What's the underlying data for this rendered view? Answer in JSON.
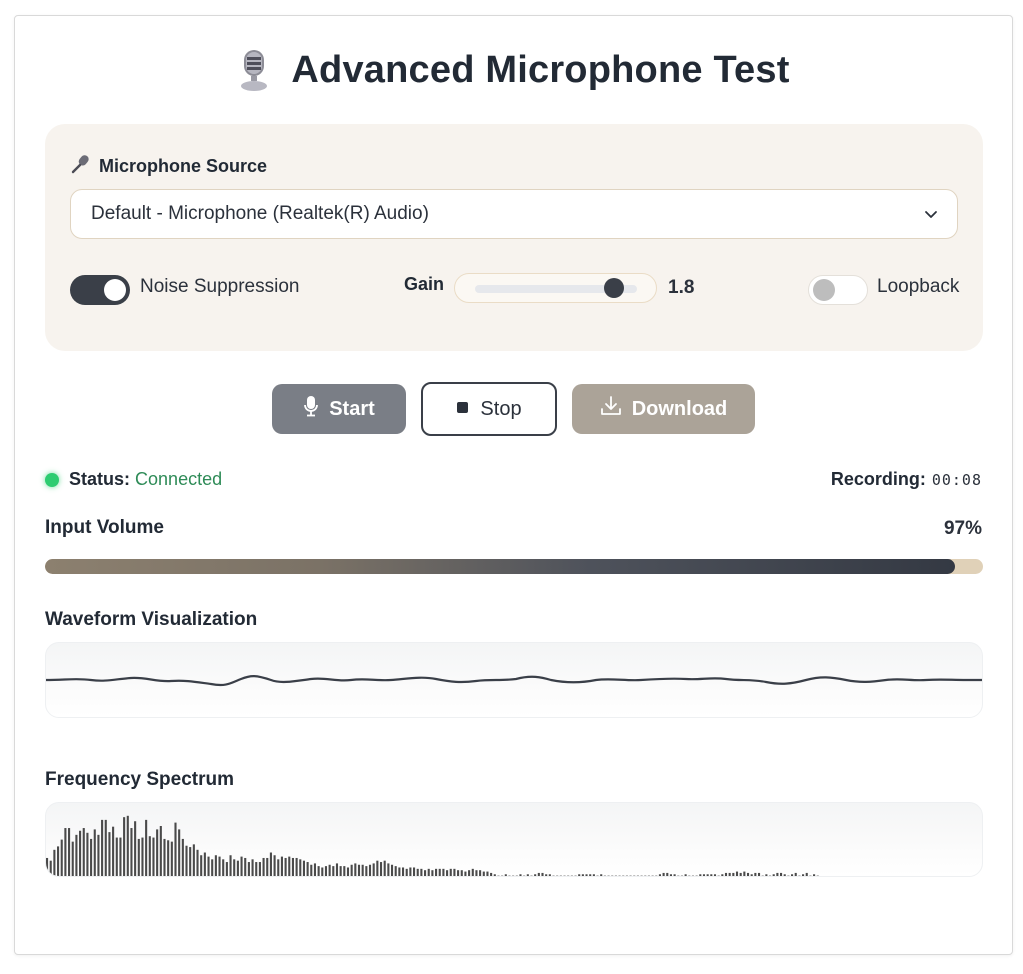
{
  "header": {
    "title": "Advanced Microphone Test",
    "icon": "studio-microphone-icon"
  },
  "source": {
    "label": "Microphone Source",
    "icon": "microphone-icon",
    "selected": "Default - Microphone (Realtek(R) Audio)"
  },
  "controls": {
    "noise_suppression": {
      "label": "Noise Suppression",
      "enabled": true
    },
    "gain": {
      "label": "Gain",
      "value": "1.8",
      "level": 0.86
    },
    "loopback": {
      "label": "Loopback",
      "enabled": false
    }
  },
  "buttons": {
    "start_label": "Start",
    "stop_label": "Stop",
    "download_label": "Download"
  },
  "status": {
    "label": "Status:",
    "value": "Connected",
    "recording_label": "Recording:",
    "recording_time": "00:08"
  },
  "volume": {
    "label": "Input Volume",
    "percent_text": "97%",
    "level": 0.97
  },
  "waveform": {
    "label": "Waveform Visualization"
  },
  "spectrum": {
    "label": "Frequency Spectrum",
    "bars": [
      0.28,
      0.24,
      0.4,
      0.45,
      0.55,
      0.72,
      0.72,
      0.52,
      0.62,
      0.68,
      0.72,
      0.65,
      0.56,
      0.7,
      0.62,
      0.84,
      0.84,
      0.66,
      0.74,
      0.58,
      0.58,
      0.88,
      0.9,
      0.72,
      0.82,
      0.56,
      0.58,
      0.84,
      0.6,
      0.58,
      0.7,
      0.75,
      0.56,
      0.54,
      0.52,
      0.8,
      0.7,
      0.56,
      0.46,
      0.44,
      0.48,
      0.4,
      0.32,
      0.36,
      0.3,
      0.26,
      0.32,
      0.3,
      0.26,
      0.22,
      0.32,
      0.26,
      0.24,
      0.3,
      0.28,
      0.22,
      0.26,
      0.22,
      0.22,
      0.28,
      0.28,
      0.36,
      0.32,
      0.26,
      0.3,
      0.28,
      0.3,
      0.28,
      0.28,
      0.26,
      0.24,
      0.22,
      0.18,
      0.2,
      0.16,
      0.14,
      0.16,
      0.18,
      0.16,
      0.2,
      0.16,
      0.16,
      0.14,
      0.18,
      0.2,
      0.18,
      0.18,
      0.16,
      0.18,
      0.2,
      0.24,
      0.22,
      0.24,
      0.2,
      0.18,
      0.16,
      0.14,
      0.14,
      0.12,
      0.14,
      0.14,
      0.12,
      0.12,
      0.1,
      0.12,
      0.1,
      0.12,
      0.12,
      0.12,
      0.1,
      0.12,
      0.12,
      0.1,
      0.1,
      0.08,
      0.1,
      0.12,
      0.1,
      0.1,
      0.08,
      0.08,
      0.06,
      0.04,
      0.02,
      0.02,
      0.04,
      0.02,
      0.02,
      0.02,
      0.04,
      0.02,
      0.04,
      0.02,
      0.04,
      0.06,
      0.06,
      0.04,
      0.04,
      0.02,
      0.02,
      0.02,
      0.02,
      0.02,
      0.02,
      0.02,
      0.04,
      0.04,
      0.04,
      0.04,
      0.04,
      0.02,
      0.04,
      0.02,
      0.02,
      0.02,
      0.02,
      0.02,
      0.02,
      0.02,
      0.02,
      0.02,
      0.02,
      0.02,
      0.02,
      0.02,
      0.02,
      0.02,
      0.04,
      0.06,
      0.06,
      0.04,
      0.04,
      0.02,
      0.02,
      0.04,
      0.02,
      0.02,
      0.02,
      0.04,
      0.04,
      0.04,
      0.04,
      0.04,
      0.02,
      0.04,
      0.06,
      0.06,
      0.06,
      0.08,
      0.06,
      0.08,
      0.06,
      0.04,
      0.06,
      0.06,
      0.02,
      0.04,
      0.02,
      0.04,
      0.06,
      0.06,
      0.04,
      0.02,
      0.04,
      0.06,
      0.02,
      0.04,
      0.06,
      0.02,
      0.04,
      0.02
    ]
  },
  "colors": {
    "accent_dark": "#3a3f48",
    "status_green": "#2ecc71",
    "panel_bg": "#f7f3ee"
  }
}
